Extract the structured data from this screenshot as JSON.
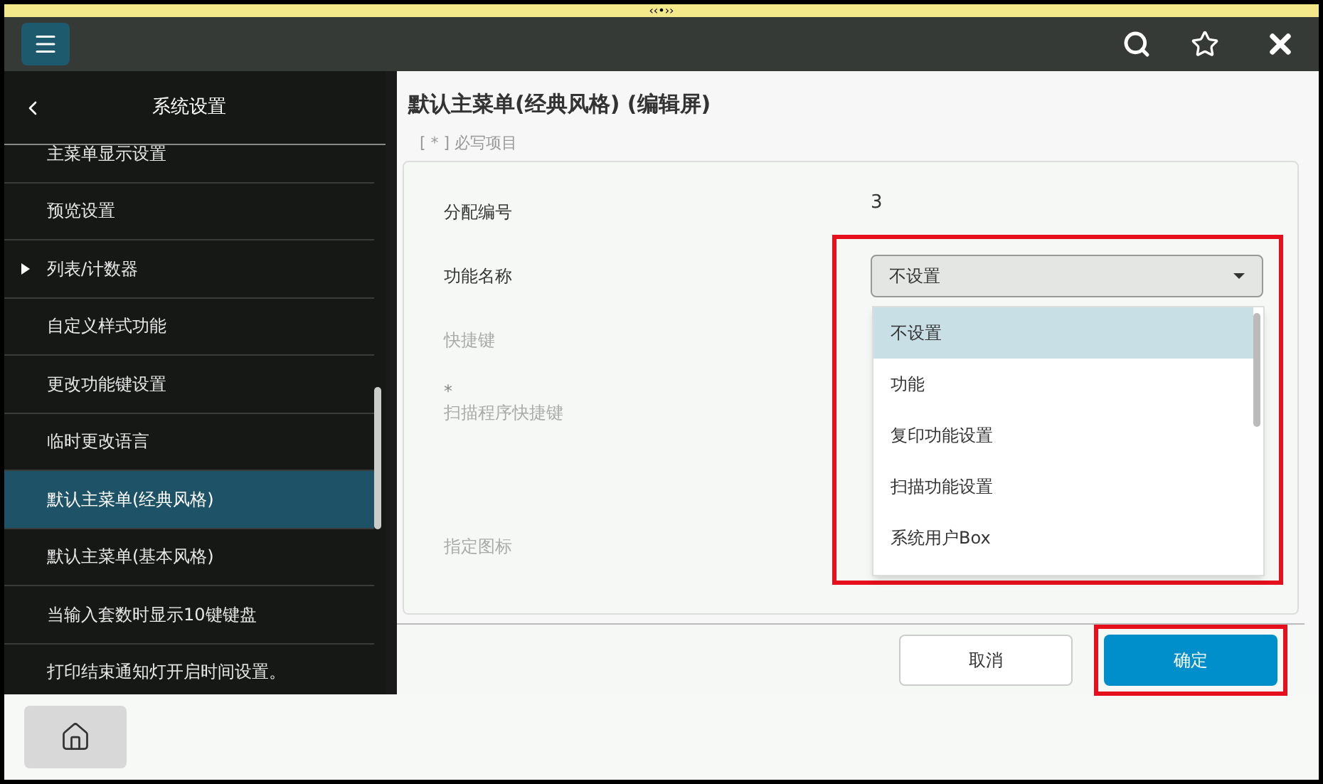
{
  "top_handle": "‹‹•››",
  "sidebar": {
    "title": "系统设置",
    "items": [
      {
        "label": "主菜单显示设置",
        "selected": false,
        "expandable": false
      },
      {
        "label": "预览设置",
        "selected": false,
        "expandable": false
      },
      {
        "label": "列表/计数器",
        "selected": false,
        "expandable": true
      },
      {
        "label": "自定义样式功能",
        "selected": false,
        "expandable": false
      },
      {
        "label": "更改功能键设置",
        "selected": false,
        "expandable": false
      },
      {
        "label": "临时更改语言",
        "selected": false,
        "expandable": false
      },
      {
        "label": "默认主菜单(经典风格)",
        "selected": true,
        "expandable": false
      },
      {
        "label": "默认主菜单(基本风格)",
        "selected": false,
        "expandable": false
      },
      {
        "label": "当输入套数时显示10键键盘",
        "selected": false,
        "expandable": false
      },
      {
        "label": "打印结束通知灯开启时间设置。",
        "selected": false,
        "expandable": false
      }
    ]
  },
  "page_title": "默认主菜单(经典风格) (编辑屏)",
  "required_note": "[ * ] 必写项目",
  "fields": [
    {
      "kind": "value",
      "label": "分配编号",
      "value": "3",
      "disabled": false
    },
    {
      "kind": "select",
      "label": "功能名称",
      "value": "不设置",
      "disabled": false,
      "highlighted": true
    },
    {
      "kind": "blank",
      "label": "快捷键",
      "disabled": true
    },
    {
      "kind": "blank",
      "label": "扫描程序快捷键",
      "required_mark": "*",
      "disabled": true
    },
    {
      "kind": "blank",
      "label": "指定图标",
      "disabled": true
    }
  ],
  "dropdown_options": [
    {
      "label": "不设置",
      "selected": true
    },
    {
      "label": "功能",
      "selected": false
    },
    {
      "label": "复印功能设置",
      "selected": false
    },
    {
      "label": "扫描功能设置",
      "selected": false
    },
    {
      "label": "系统用户Box",
      "selected": false
    }
  ],
  "buttons": [
    {
      "label": "取消",
      "kind": "secondary",
      "highlighted": false
    },
    {
      "label": "确定",
      "kind": "primary",
      "highlighted": true
    }
  ]
}
